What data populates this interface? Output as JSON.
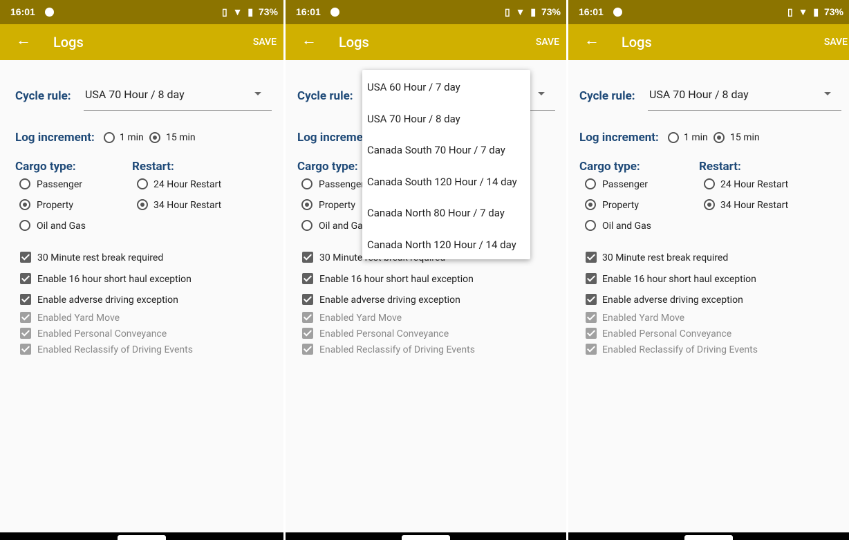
{
  "status": {
    "time": "16:01",
    "battery": "73%",
    "vibrate_icon": "vibrate-icon",
    "wifi_icon": "wifi-icon",
    "battery_icon": "battery-icon"
  },
  "appbar": {
    "title": "Logs",
    "save": "SAVE",
    "back_icon": "arrow-left-icon"
  },
  "cycle": {
    "label": "Cycle rule:",
    "value": "USA 70 Hour / 8 day"
  },
  "log_increment": {
    "label": "Log increment:",
    "options": [
      "1 min",
      "15 min"
    ],
    "selected": "15 min"
  },
  "cargo": {
    "label": "Cargo type:",
    "options": [
      "Passenger",
      "Property",
      "Oil and Gas"
    ],
    "selected": "Property"
  },
  "restart": {
    "label": "Restart:",
    "options": [
      "24 Hour Restart",
      "34 Hour Restart"
    ],
    "selected": "34 Hour Restart"
  },
  "checkboxes": [
    {
      "label": "30 Minute rest break required",
      "checked": true,
      "enabled": true
    },
    {
      "label": "Enable 16 hour short haul exception",
      "checked": true,
      "enabled": true
    },
    {
      "label": "Enable adverse driving exception",
      "checked": true,
      "enabled": true
    },
    {
      "label": "Enabled Yard Move",
      "checked": true,
      "enabled": false
    },
    {
      "label": "Enabled Personal Conveyance",
      "checked": true,
      "enabled": false
    },
    {
      "label": "Enabled Reclassify of Driving Events",
      "checked": true,
      "enabled": false
    }
  ],
  "dropdown": {
    "options": [
      "USA 60 Hour / 7 day",
      "USA 70 Hour / 8 day",
      "Canada South 70 Hour / 7 day",
      "Canada South 120 Hour / 14 day",
      "Canada North 80 Hour / 7 day",
      "Canada North 120 Hour / 14 day"
    ]
  },
  "colors": {
    "statusbar": "#8c7400",
    "appbar": "#d0b000",
    "label": "#1f4a78"
  }
}
